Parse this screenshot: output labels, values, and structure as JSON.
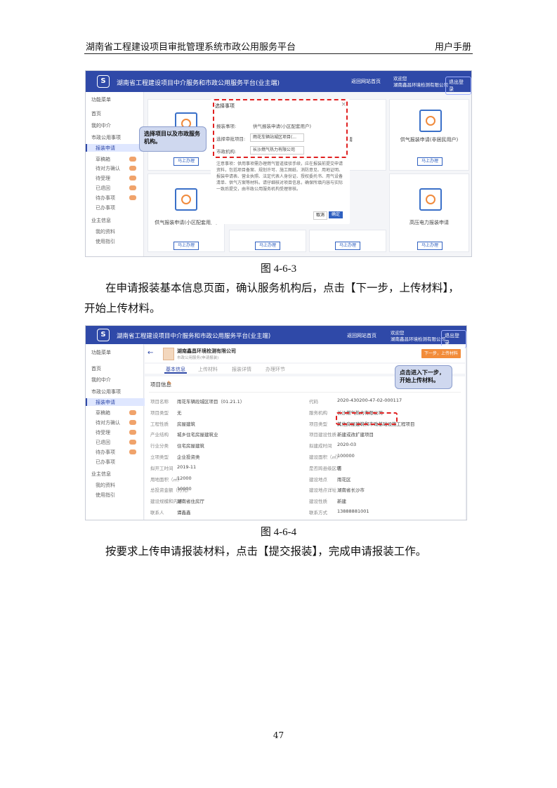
{
  "header": {
    "left": "湖南省工程建设项目审批管理系统市政公用服务平台",
    "right": "用户手册"
  },
  "shot1": {
    "app_title": "湖南省工程建设项目中介服务和市政公用服务平台(业主端)",
    "home_btn": "返回网站首页",
    "welcome_line1": "欢迎您",
    "welcome_line2": "湖南鑫昌环境检测有限公司",
    "logout_btn": "退出登录",
    "menu_title": "功能菜单",
    "menu": [
      "首页",
      "我的中介",
      "市政公用事项",
      "报装申请",
      "草稿箱",
      "待对方确认",
      "待受理",
      "已退回",
      "待办事项",
      "已办事项",
      "业主信息",
      "我的资料",
      "使用指引"
    ],
    "cards": [
      {
        "label": "",
        "btn": "马上办理"
      },
      {
        "label": "申请",
        "btn": ""
      },
      {
        "label": "供气报装申请(非居民用户)",
        "btn": "马上办理"
      },
      {
        "label": "供气报装申请(小区配套用户)",
        "btn": "马上办理"
      },
      {
        "label": "",
        "btn": "马上办理"
      },
      {
        "label": "",
        "btn": "马上办理"
      },
      {
        "label": "高压电力报装申请",
        "btn": "马上办理"
      }
    ],
    "modal": {
      "title": "选择事项",
      "row1_label": "报装事项:",
      "row1_value": "供气报装申请(小区配套用户)",
      "row2_label": "选择审批项目:",
      "row2_value": "雨花车辆站城区项目(...",
      "row3_label": "市政机构:",
      "row3_value": "长沙燃气热力有限公司",
      "desc": "注意事项：供用事项需办理燃气管道接驳手续，应在报装前提交申请资料，包括项目备案、规划许可、施工图纸、消防意见、用地证明、报装申请表、营业执照、法定代表人身份证、授权委托书、用气设备清单、供气方案等材料。请仔细核对项目信息，确保所填内容与实际一致后提交，由市政公用服务机构受理审核。",
      "cancel": "取消",
      "confirm": "确定"
    },
    "callout": "选择项目以及市政服务机构。"
  },
  "caption1": "图 4-6-3",
  "para1_line1": "在申请报装基本信息页面，确认服务机构后，点击【下一步，上传材料】，",
  "para1_line2": "开始上传材料。",
  "shot2": {
    "app_title": "湖南省工程建设项目中介服务和市政公用服务平台(业主端)",
    "home_btn": "返回网站首页",
    "welcome_line1": "欢迎您",
    "welcome_line2": "湖南鑫昌环境检测有限公司",
    "logout_btn": "退出登录",
    "menu_title": "功能菜单",
    "menu": [
      "首页",
      "我的中介",
      "市政公用事项",
      "报装申请",
      "草稿箱",
      "待对方确认",
      "待受理",
      "已退回",
      "待办事项",
      "已办事项",
      "业主信息",
      "我的资料",
      "使用指引"
    ],
    "company": "湖南鑫昌环境检测有限公司",
    "company_sub": "市政公用服务(申请报装)",
    "next_btn": "下一步，上传材料",
    "tabs": [
      "基本信息",
      "上传材料",
      "报装详情",
      "办理环节"
    ],
    "section_title": "项目信息",
    "callout": "点击进入下一步，开始上传材料。",
    "left_fields": [
      {
        "label": "项目名称",
        "value": "雨花车辆段城区项目（01.21.1）"
      },
      {
        "label": "项目类型",
        "value": "无"
      },
      {
        "label": "工程性质",
        "value": "房屋建筑"
      },
      {
        "label": "产业结构",
        "value": "城乡住宅房屋建筑业"
      },
      {
        "label": "行业分类",
        "value": "住宅房屋建筑"
      },
      {
        "label": "立项类型",
        "value": "企业投资类"
      },
      {
        "label": "拟开工时间",
        "value": "2019-11"
      },
      {
        "label": "用地面积（㎡）",
        "value": "12000"
      },
      {
        "label": "总投资金额（万元）",
        "value": "10000"
      },
      {
        "label": "建设规模和内容",
        "value": "湖南省住房厅"
      },
      {
        "label": "联系人",
        "value": "谭鑫鑫"
      }
    ],
    "right_fields": [
      {
        "label": "代码",
        "value": "2020-430200-47-02-000117"
      },
      {
        "label": "服务机构",
        "value": "长沙燃气热力有限公司"
      },
      {
        "label": "项目类型",
        "value": "其他房屋建筑和市政基础设施工程项目"
      },
      {
        "label": "项目建设性质",
        "value": "新建或改扩建项目"
      },
      {
        "label": "拟建成时间",
        "value": "2020-03"
      },
      {
        "label": "建设面积（㎡）",
        "value": "100000"
      },
      {
        "label": "是否跨县级区域",
        "value": "否"
      },
      {
        "label": "建设地点",
        "value": "雨花区"
      },
      {
        "label": "建设地点详址",
        "value": "湖南省长沙市"
      },
      {
        "label": "建设性质",
        "value": "新建"
      },
      {
        "label": "联系方式",
        "value": "13888881001"
      }
    ]
  },
  "caption2": "图 4-6-4",
  "para2": "按要求上传申请报装材料，点击【提交报装】，完成申请报装工作。",
  "page_number": "47",
  "colors": {
    "brand": "#2f49a8",
    "accent": "#f08a3c",
    "highlight": "#e02020",
    "callout": "#cfd8ef"
  }
}
